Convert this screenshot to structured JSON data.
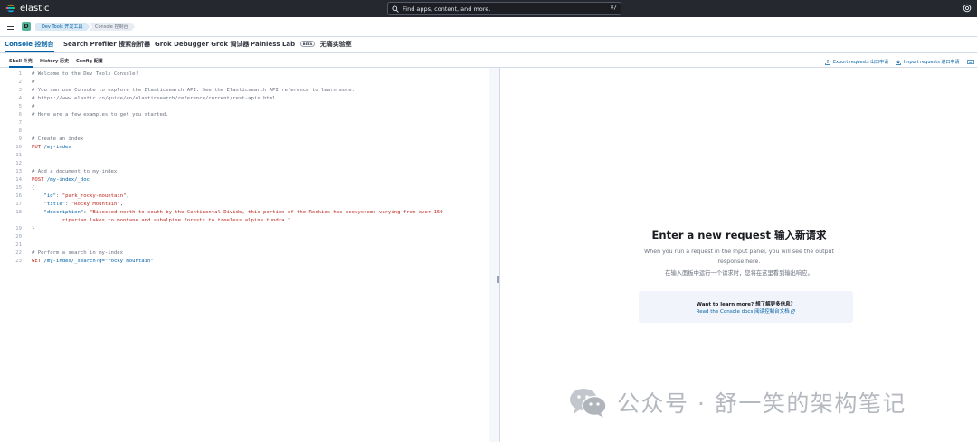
{
  "header": {
    "brand": "elastic",
    "search_placeholder": "Find apps, content, and more.",
    "search_shortcut": "⌘/"
  },
  "breadcrumbs": {
    "space_initial": "D",
    "items": [
      {
        "label": "Dev Tools  开发工具"
      },
      {
        "label": "Console  控制台"
      }
    ]
  },
  "tabs": [
    {
      "label": "Console  控制台",
      "active": true
    },
    {
      "label": "Search Profiler  搜索剖析器",
      "active": false
    },
    {
      "label": "Grok Debugger  Grok 调试器",
      "active": false
    },
    {
      "label": "Painless Lab",
      "badge": "BETA",
      "suffix": "无痛实验室",
      "active": false
    }
  ],
  "subtabs": [
    {
      "label": "Shell  外壳",
      "active": true
    },
    {
      "label": "History  历史",
      "active": false
    },
    {
      "label": "Config  配置",
      "active": false
    }
  ],
  "actions": {
    "export": "Export requests  出口申请",
    "import": "Import requests  进口申请"
  },
  "editor": {
    "lines": [
      {
        "n": "1",
        "text": "# Welcome to the Dev Tools Console!",
        "type": "comment"
      },
      {
        "n": "2",
        "text": "#",
        "type": "comment"
      },
      {
        "n": "3",
        "text": "# You can use Console to explore the Elasticsearch API. See the Elasticsearch API reference to learn more:",
        "type": "comment"
      },
      {
        "n": "4",
        "text": "# https://www.elastic.co/guide/en/elasticsearch/reference/current/rest-apis.html",
        "type": "comment"
      },
      {
        "n": "5",
        "text": "#",
        "type": "comment"
      },
      {
        "n": "6",
        "text": "# Here are a few examples to get you started.",
        "type": "comment"
      },
      {
        "n": "7",
        "text": "",
        "type": "comment"
      },
      {
        "n": "8",
        "text": "",
        "type": "comment"
      },
      {
        "n": "9",
        "text": "# Create an index",
        "type": "comment"
      },
      {
        "n": "10",
        "method": "PUT",
        "path": "/my-index",
        "type": "request"
      },
      {
        "n": "11",
        "text": "",
        "type": "comment"
      },
      {
        "n": "12",
        "text": "",
        "type": "comment"
      },
      {
        "n": "13",
        "text": "# Add a document to my-index",
        "type": "comment"
      },
      {
        "n": "14",
        "method": "POST",
        "path": "/my-index/_doc",
        "type": "request"
      },
      {
        "n": "15",
        "text": "{",
        "type": "punc"
      },
      {
        "n": "16",
        "key": "\"id\"",
        "value": "\"park_rocky-mountain\"",
        "trail": ",",
        "type": "kv"
      },
      {
        "n": "17",
        "key": "\"title\"",
        "value": "\"Rocky Mountain\"",
        "trail": ",",
        "type": "kv"
      },
      {
        "n": "18",
        "key": "\"description\"",
        "value": "\"Bisected north to south by the Continental Divide, this portion of the Rockies has ecosystems varying from over 150",
        "trail": "",
        "type": "kv"
      },
      {
        "n": "",
        "text": "riparian lakes to montane and subalpine forests to treeless alpine tundra.\"",
        "type": "wrap"
      },
      {
        "n": "19",
        "text": "}",
        "type": "punc"
      },
      {
        "n": "20",
        "text": "",
        "type": "comment"
      },
      {
        "n": "21",
        "text": "",
        "type": "comment"
      },
      {
        "n": "22",
        "text": "# Perform a search in my-index",
        "type": "comment"
      },
      {
        "n": "23",
        "method": "GET",
        "path": "/my-index/_search?q=\"rocky mountain\"",
        "type": "request"
      }
    ]
  },
  "output": {
    "title": "Enter a new request  输入新请求",
    "desc": "When you run a request in the Input panel, you will see the output response here.",
    "desc_cn": "在输入面板中运行一个请求时，您将在这里看到输出响应。",
    "learn_question": "Want to learn more?  想了解更多信息？",
    "learn_link": "Read the Console docs  阅读控制台文档"
  },
  "watermark": {
    "text": "公众号 · 舒一笑的架构笔记"
  },
  "colors": {
    "header_bg": "#25282f",
    "accent": "#0061a6",
    "string": "#bd271e",
    "comment": "#69707d"
  }
}
